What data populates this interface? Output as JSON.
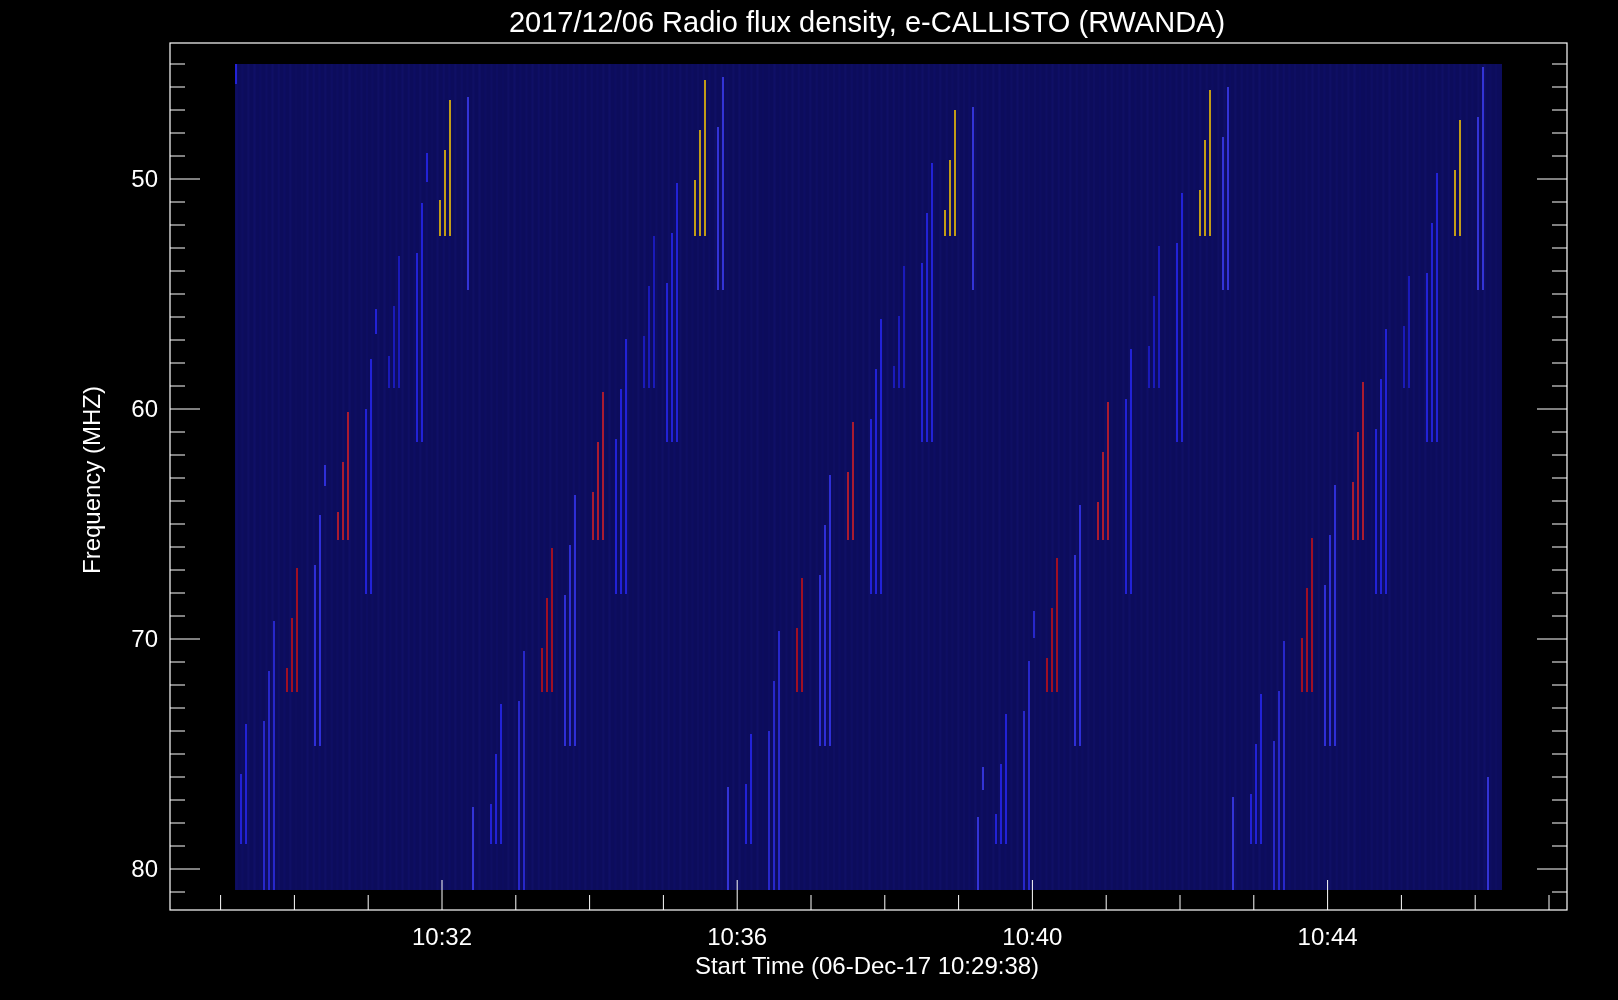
{
  "title": "2017/12/06  Radio flux density, e-CALLISTO (RWANDA)",
  "plot": {
    "ylabel": "Frequency (MHZ)",
    "xlabel": "Start Time (06-Dec-17 10:29:38)",
    "yticks": [
      "50",
      "60",
      "70",
      "80"
    ],
    "xticks": [
      "10:32",
      "10:36",
      "10:40",
      "10:44"
    ]
  }
}
